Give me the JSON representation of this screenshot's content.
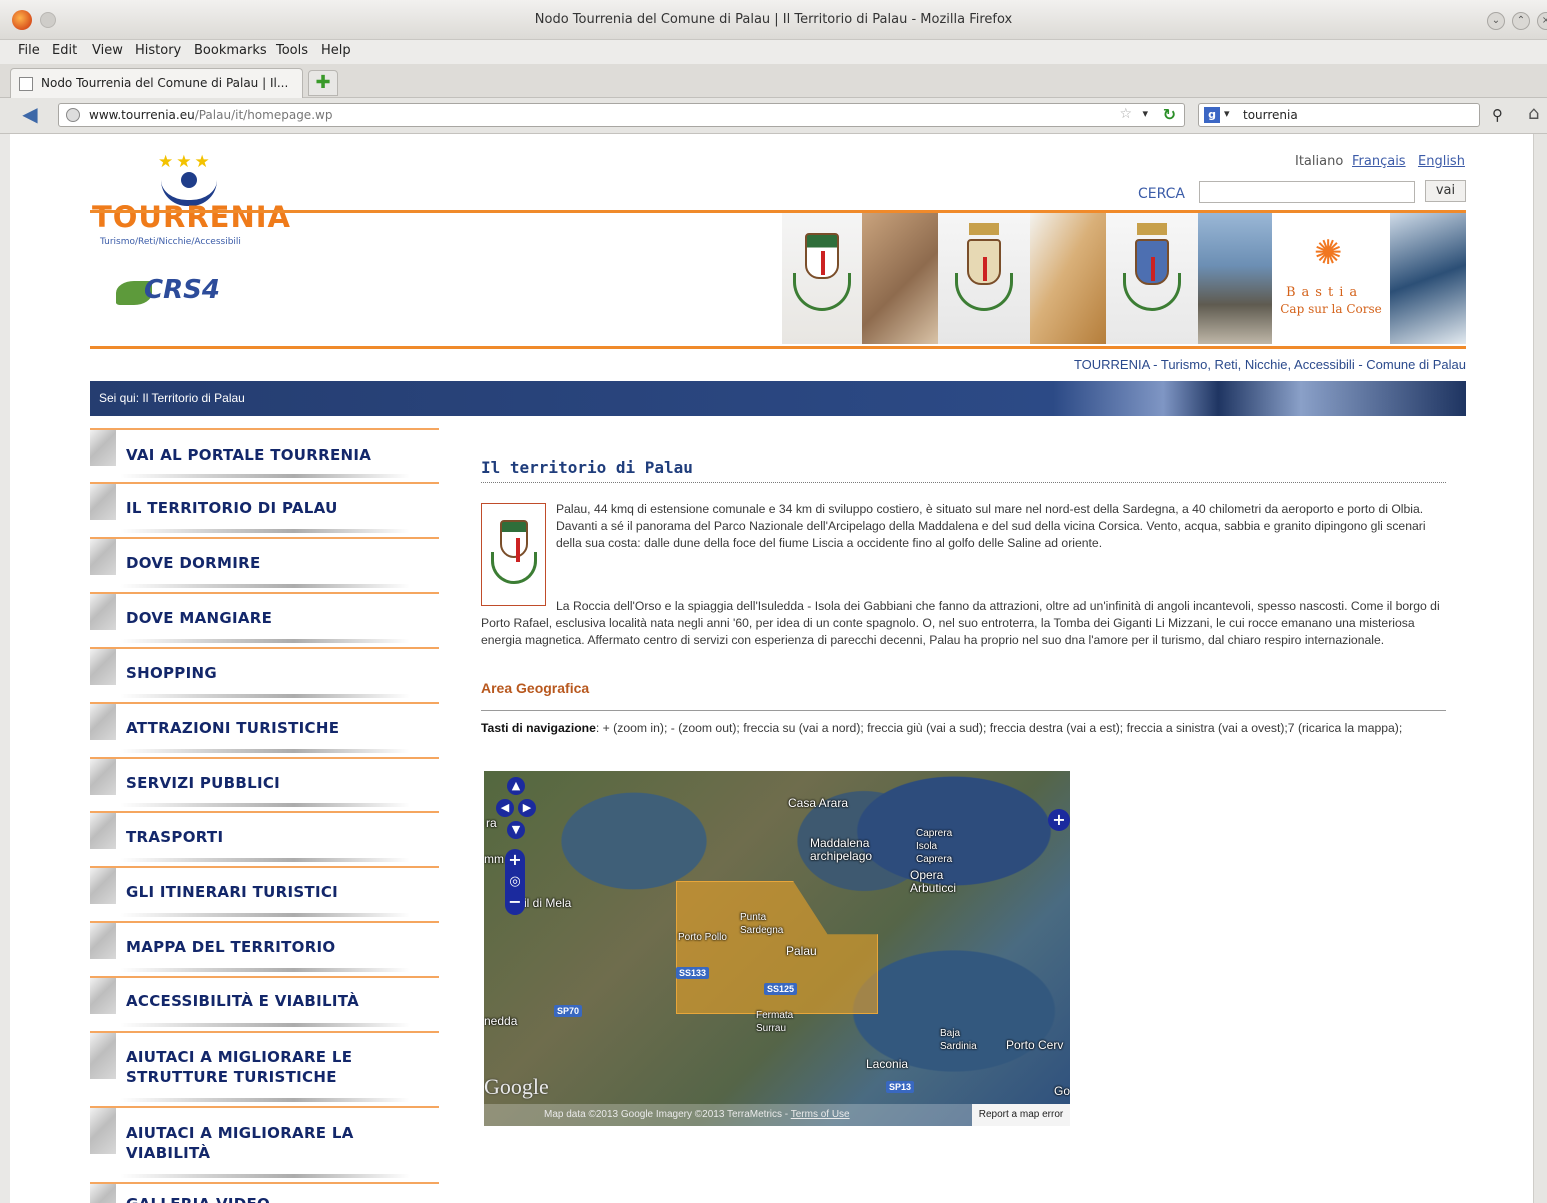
{
  "window": {
    "title": "Nodo Tourrenia del Comune di Palau | Il Territorio di Palau - Mozilla Firefox"
  },
  "menu": [
    "File",
    "Edit",
    "View",
    "History",
    "Bookmarks",
    "Tools",
    "Help"
  ],
  "tab": {
    "label": "Nodo Tourrenia del Comune di Palau | Il...",
    "new_tab_icon": "plus-icon"
  },
  "navbar": {
    "url_domain": "www.tourrenia.eu",
    "url_path": "/Palau/it/homepage.wp",
    "search_query": "tourrenia",
    "search_engine_icon": "google-icon"
  },
  "header": {
    "logo_text": "TOURRENIA",
    "logo_sub": "Turismo/Reti/Nicchie/Accessibili",
    "partner_logo": "CRS4",
    "lang_it": "Italiano",
    "lang_fr": "Français",
    "lang_en": "English",
    "search_label": "CERCA",
    "search_value": "",
    "search_button": "vai",
    "bastia_line1": "Bastia",
    "bastia_line2": "Cap sur la Corse",
    "tagline": "TOURRENIA - Turismo, Reti, Nicchie, Accessibili - Comune di Palau",
    "accent_color": "#f08a2a",
    "brand_blue": "#2c4a86"
  },
  "breadcrumb": "Sei qui: Il Territorio di Palau",
  "sidebar": {
    "items": [
      {
        "label": "VAI AL PORTALE TOURRENIA"
      },
      {
        "label": "IL TERRITORIO DI PALAU"
      },
      {
        "label": "DOVE DORMIRE"
      },
      {
        "label": "DOVE MANGIARE"
      },
      {
        "label": "SHOPPING"
      },
      {
        "label": "ATTRAZIONI TURISTICHE"
      },
      {
        "label": "SERVIZI PUBBLICI"
      },
      {
        "label": "TRASPORTI"
      },
      {
        "label": "GLI ITINERARI TURISTICI"
      },
      {
        "label": "MAPPA DEL TERRITORIO"
      },
      {
        "label": "ACCESSIBILITÀ E VIABILITÀ"
      },
      {
        "label": "AIUTACI A MIGLIORARE LE STRUTTURE TURISTICHE"
      },
      {
        "label": "AIUTACI A MIGLIORARE LA VIABILITÀ"
      },
      {
        "label": "GALLERIA VIDEO"
      }
    ]
  },
  "main": {
    "title": "Il territorio di Palau",
    "para1": "Palau, 44 kmq di estensione comunale e 34 km di sviluppo costiero, è situato sul mare nel nord-est della Sardegna, a 40 chilometri da aeroporto e porto di Olbia. Davanti a sé il panorama del Parco Nazionale dell'Arcipelago della Maddalena e del sud della vicina Corsica. Vento, acqua, sabbia e granito dipingono gli scenari della sua costa: dalle dune della foce del fiume Liscia a occidente fino al golfo delle Saline ad oriente.",
    "para2": "La Roccia dell'Orso e la spiaggia dell'Isuledda - Isola dei Gabbiani che fanno da attrazioni, oltre ad un'infinità di angoli incantevoli, spesso nascosti. Come il borgo di Porto Rafael, esclusiva località nata negli anni '60, per idea di un conte spagnolo. O, nel suo entroterra, la Tomba dei Giganti Li Mizzani, le cui rocce emanano una misteriosa energia magnetica. Affermato centro di servizi con esperienza di parecchi decenni, Palau ha proprio nel suo dna l'amore per il turismo, dal chiaro respiro internazionale.",
    "area_title": "Area Geografica",
    "navkeys_label": "Tasti di navigazione",
    "navkeys_text": ": + (zoom in); - (zoom out); freccia su (vai a nord); freccia giù (vai a sud); freccia destra (vai a est); freccia a sinistra (vai a ovest);7 (ricarica la mappa);"
  },
  "map": {
    "places": {
      "casa_arara": "Casa Arara",
      "maddalena": "Maddalena archipelago",
      "caprera_isola": "Caprera Isola Caprera",
      "opera_arbuticci": "Opera Arbuticci",
      "punta_sardegna": "Punta Sardegna",
      "porto_pollo": "Porto Pollo",
      "palau": "Palau",
      "fermata_surrau": "Fermata Surrau",
      "laconia": "Laconia",
      "baja_sardinia": "Baja Sardinia",
      "porto_cervo": "Porto Cerv",
      "mela": "il di Mela",
      "edda": "nedda",
      "ra": "ra",
      "mm": "mm",
      "go": "Go"
    },
    "roads": {
      "ss133": "SS133",
      "ss125": "SS125",
      "sp70": "SP70",
      "sp13": "SP13"
    },
    "google": "Google",
    "attribution": "Map data ©2013 Google Imagery ©2013 TerraMetrics - ",
    "terms": "Terms of Use",
    "report": "Report a map error"
  }
}
